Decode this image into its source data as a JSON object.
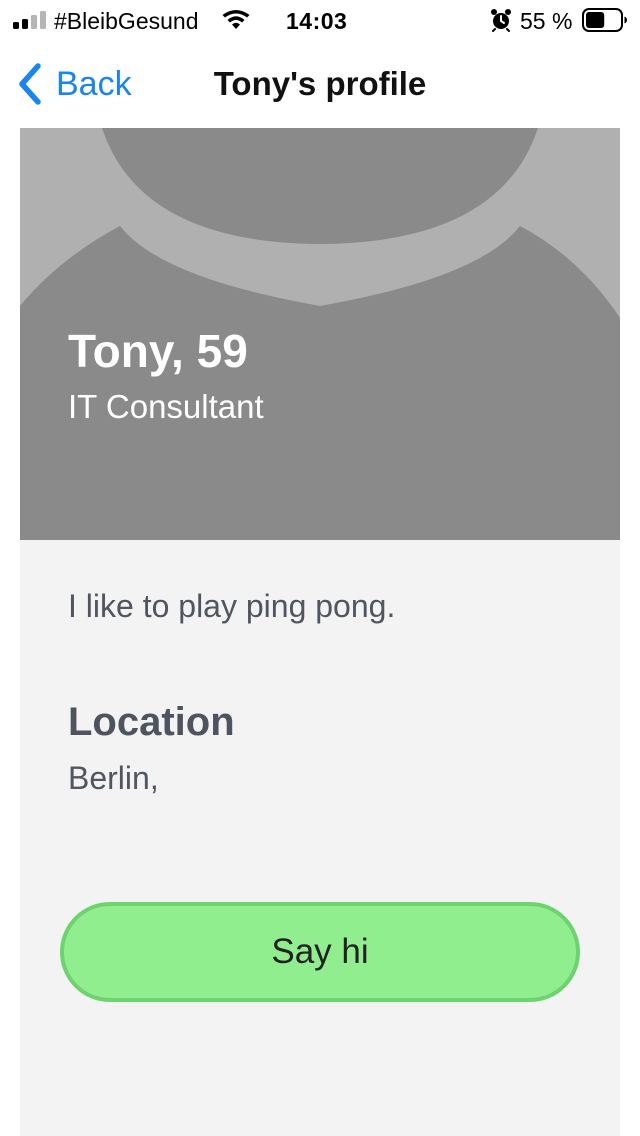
{
  "status_bar": {
    "carrier": "#BleibGesund",
    "time": "14:03",
    "battery_percent": "55 %",
    "signal_bars_filled": 2,
    "signal_bars_total": 4,
    "battery_level": 0.55
  },
  "nav": {
    "back_label": "Back",
    "title": "Tony's profile"
  },
  "profile": {
    "name_age": "Tony, 59",
    "job_title": "IT Consultant",
    "bio": "I like to play ping pong.",
    "location_heading": "Location",
    "location_value": "Berlin,"
  },
  "actions": {
    "say_hi_label": "Say hi"
  },
  "colors": {
    "accent": "#1a84f2",
    "button_fill": "#90ee8e",
    "button_border": "#6cd36e",
    "hero_background": "#8a8a8a",
    "card_background": "#f3f3f3"
  },
  "icons": {
    "signal": "cellular-signal-icon",
    "wifi": "wifi-icon",
    "alarm": "alarm-clock-icon",
    "battery": "battery-icon",
    "back": "chevron-left-icon",
    "avatar": "avatar-placeholder-icon"
  }
}
